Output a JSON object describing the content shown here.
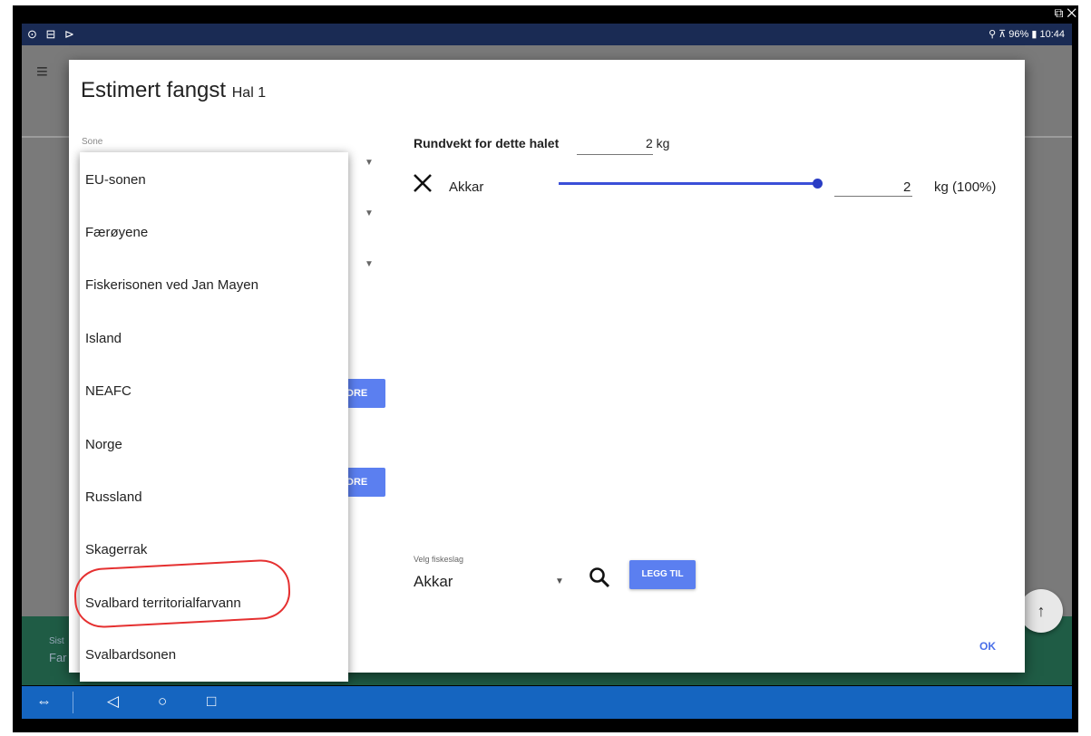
{
  "status_bar": {
    "left_icons": "⊙ ⊟ ⊳",
    "right_text": "⚲ ⊼ 96% ▮ 10:44"
  },
  "window_controls": "⧉ ✕",
  "app": {
    "greenbar_text_1": "Sist",
    "greenbar_text_2": "Far"
  },
  "dialog": {
    "title": "Estimert fangst",
    "subtitle": "Hal 1",
    "sone_label": "Sone",
    "hidden_button_1": "DRE",
    "hidden_button_2": "DRE",
    "rundvekt_label": "Rundvekt for dette halet",
    "rundvekt_value": "2 kg",
    "species_row": {
      "name": "Akkar",
      "slider_fraction": 1.0,
      "kg_value": "2",
      "unit": "kg (100%)"
    },
    "velg_label": "Velg fiskeslag",
    "velg_value": "Akkar",
    "add_button": "LEGG TIL",
    "ok_button": "OK"
  },
  "dropdown": {
    "items": [
      "EU-sonen",
      "Færøyene",
      "Fiskerisonen ved Jan Mayen",
      "Island",
      "NEAFC",
      "Norge",
      "Russland",
      "Skagerrak",
      "Svalbard territorialfarvann",
      "Svalbardsonen"
    ],
    "highlighted": "Svalbard territorialfarvann",
    "annotation_color": "#e53030"
  },
  "icons": {
    "menu": "≡",
    "fab": "↑",
    "nav_back": "◁",
    "nav_home": "○",
    "nav_recent": "□",
    "teamviewer": "⇔"
  },
  "colors": {
    "accent": "#5b7ff0",
    "slider": "#3b4fd8",
    "navbar": "#1565c0",
    "status_bar": "#1a2b54"
  }
}
